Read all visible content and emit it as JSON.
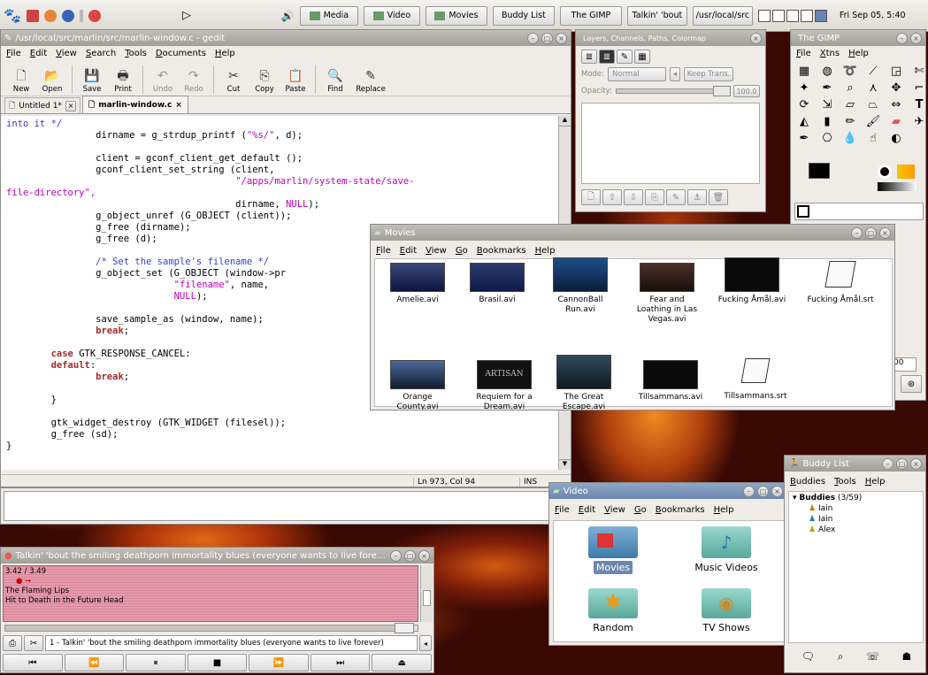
{
  "panel": {
    "media": "Media",
    "video": "Video",
    "movies": "Movies",
    "buddy": "Buddy List",
    "gimp": "The GIMP",
    "talkin": "Talkin' 'bout",
    "path": "/usr/local/src",
    "clock": "Fri Sep 05, 5:40"
  },
  "gedit": {
    "title": "/usr/local/src/marlin/src/marlin-window.c - gedit",
    "menu": [
      "File",
      "Edit",
      "View",
      "Search",
      "Tools",
      "Documents",
      "Help"
    ],
    "tools": [
      "New",
      "Open",
      "Save",
      "Print",
      "Undo",
      "Redo",
      "Cut",
      "Copy",
      "Paste",
      "Find",
      "Replace"
    ],
    "tab1": "Untitled 1*",
    "tab2": "marlin-window.c",
    "code": [
      "into it */",
      "                dirname = g_strdup_printf (\"%s/\", d);",
      "",
      "                client = gconf_client_get_default ();",
      "                gconf_client_set_string (client,",
      "                                         \"/apps/marlin/system-state/save-",
      "file-directory\",",
      "                                         dirname, NULL);",
      "                g_object_unref (G_OBJECT (client));",
      "                g_free (dirname);",
      "                g_free (d);",
      "",
      "                /* Set the sample's filename */",
      "                g_object_set (G_OBJECT (window->pr",
      "                              \"filename\", name,",
      "                              NULL);",
      "",
      "                save_sample_as (window, name);",
      "                break;",
      "",
      "        case GTK_RESPONSE_CANCEL:",
      "        default:",
      "                break;",
      "",
      "        }",
      "",
      "        gtk_widget_destroy (GTK_WIDGET (filesel));",
      "        g_free (sd);",
      "}"
    ],
    "status_pos": "Ln 973, Col 94",
    "status_ins": "INS"
  },
  "layers": {
    "title": "Layers, Channels, Paths, Colormap",
    "mode_label": "Mode:",
    "mode": "Normal",
    "keep": "Keep Trans.",
    "opacity_label": "Opacity:",
    "opacity": "100.0"
  },
  "gimp": {
    "title": "The GIMP",
    "menu": [
      "File",
      "Xtns",
      "Help"
    ],
    "spin": "00"
  },
  "movies": {
    "title": "Movies",
    "menu": [
      "File",
      "Edit",
      "View",
      "Go",
      "Bookmarks",
      "Help"
    ],
    "files": [
      "Amelie.avi",
      "Brasil.avi",
      "CannonBall Run.avi",
      "Fear and Loathing in Las Vegas.avi",
      "Fucking Åmål.avi",
      "Fucking Åmål.srt",
      "Orange County.avi",
      "Requiem for a Dream.avi",
      "The Great Escape.avi",
      "Tillsammans.avi",
      "Tillsammans.srt"
    ],
    "thumb_artisan": "ARTISAN"
  },
  "video": {
    "title": "Video",
    "menu": [
      "File",
      "Edit",
      "View",
      "Go",
      "Bookmarks",
      "Help"
    ],
    "folders": [
      "Movies",
      "Music Videos",
      "Random",
      "TV Shows"
    ]
  },
  "buddy": {
    "title": "Buddy List",
    "menu": [
      "Buddies",
      "Tools",
      "Help"
    ],
    "group": "Buddies",
    "group_count": "(3/59)",
    "items": [
      "Iain",
      "Iain",
      "Alex"
    ]
  },
  "player": {
    "title": "Talkin' 'bout the smiling deathporn immortality blues (everyone wants to live forever) -",
    "time": "3.42 / 3.49",
    "artist": "The Flaming Lips",
    "album": "Hit to Death in the Future Head",
    "progress": 0.98,
    "playlist": "1 - Talkin' 'bout the smiling deathporn immortality blues (everyone wants to live forever)"
  }
}
